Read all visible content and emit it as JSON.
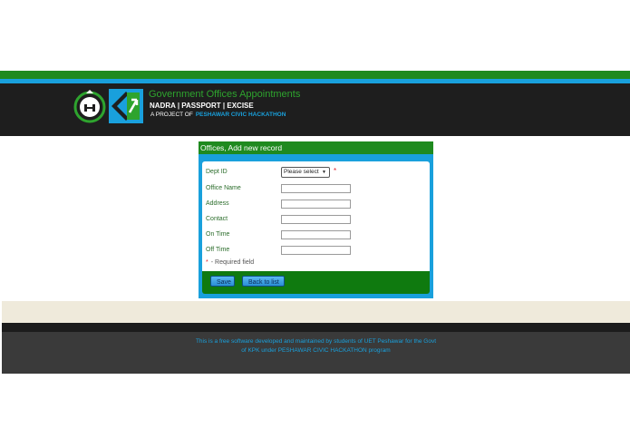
{
  "header": {
    "title": "Government Offices Appointments",
    "subtitle": "NADRA | PASSPORT | EXCISE",
    "project_prefix": "A PROJECT OF",
    "project_name": "PESHAWAR CIVIC HACKATHON"
  },
  "form": {
    "panel_title": "Offices, Add new record",
    "fields": [
      {
        "label": "Dept ID",
        "value": "Please select",
        "required": true
      },
      {
        "label": "Office Name",
        "value": ""
      },
      {
        "label": "Address",
        "value": ""
      },
      {
        "label": "Contact",
        "value": ""
      },
      {
        "label": "On Time",
        "value": ""
      },
      {
        "label": "Off Time",
        "value": ""
      }
    ],
    "required_star": "*",
    "required_note": "- Required field",
    "save_label": "Save",
    "back_label": "Back to list"
  },
  "footer": {
    "line1": "This is a free software developed and maintained by students of UET Peshawar for the Govt",
    "line2": "of KPK under PESHAWAR CIVIC HACKATHON program"
  },
  "colors": {
    "green": "#1f8a1f",
    "blue": "#19a0dc",
    "header_bg": "#1e1e1e",
    "required": "#e0202a"
  }
}
